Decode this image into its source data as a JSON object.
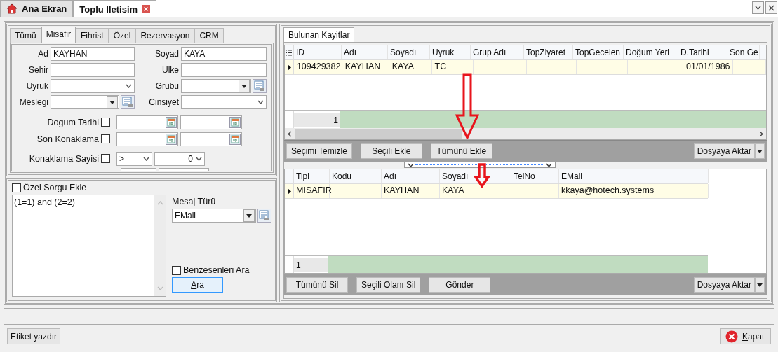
{
  "window_tabs": [
    {
      "label": "Ana Ekran",
      "selected": false,
      "kind": "home"
    },
    {
      "label": "Toplu Iletisim",
      "selected": true,
      "kind": "closable"
    }
  ],
  "filter_tabs": [
    {
      "label": "Tümü",
      "selected": false,
      "underline_first": false
    },
    {
      "label": "Misafir",
      "selected": true,
      "underline_first": true
    },
    {
      "label": "Fihrist",
      "selected": false,
      "underline_first": false
    },
    {
      "label": "Özel",
      "selected": false,
      "underline_first": false
    },
    {
      "label": "Rezervasyon",
      "selected": false,
      "underline_first": false
    },
    {
      "label": "CRM",
      "selected": false,
      "underline_first": false
    }
  ],
  "fields": [
    {
      "label": "Ad",
      "value": "KAYHAN",
      "kind": "text"
    },
    {
      "label": "Soyad",
      "value": "KAYA",
      "kind": "text"
    },
    {
      "label": "Sehir",
      "kind": "text"
    },
    {
      "label": "Ulke",
      "kind": "text"
    },
    {
      "label": "Uyruk",
      "kind": "select"
    },
    {
      "label": "Grubu",
      "kind": "lookup"
    },
    {
      "label": "Meslegi",
      "kind": "lookup"
    },
    {
      "label": "Cinsiyet",
      "kind": "select"
    }
  ],
  "range_filters": [
    {
      "label": "Dogum Tarihi",
      "checked": false,
      "kind": "date"
    },
    {
      "label": "Son Konaklama",
      "checked": false,
      "kind": "date"
    },
    {
      "label": "Konaklama Sayisi",
      "checked": false,
      "kind": "count",
      "operator": ">",
      "value": "0"
    }
  ],
  "custom_query": {
    "label": "Özel Sorgu Ekle",
    "checked": false,
    "text": "(1=1) and (2=2)"
  },
  "message_type": {
    "label": "Mesaj Türü",
    "value": "EMail"
  },
  "similar": {
    "label": "Benzesenleri Ara",
    "checked": false
  },
  "search_button": {
    "label": "Ara",
    "underline_first": true
  },
  "results": {
    "tab": "Bulunan Kayitlar",
    "columns": [
      "ID",
      "Adı",
      "Soyadı",
      "Uyruk",
      "Grup Adı",
      "TopZiyaret",
      "TopGecelen",
      "Doğum Yeri",
      "D.Tarihi",
      "Son Ge"
    ],
    "rows": [
      {
        "selected": true,
        "cells": [
          "109429382",
          "KAYHAN",
          "KAYA",
          "TC",
          "",
          "",
          "",
          "",
          "01/01/1986",
          ""
        ]
      }
    ],
    "count": "1",
    "buttons": [
      "Seçimi Temizle",
      "Seçili Ekle",
      "Tümünü Ekle"
    ],
    "export": "Dosyaya Aktar"
  },
  "recipients": {
    "columns": [
      "Tipi",
      "Kodu",
      "Adı",
      "Soyadı",
      "TelNo",
      "EMail"
    ],
    "rows": [
      {
        "selected": true,
        "cells": [
          "MISAFIR",
          "",
          "KAYHAN",
          "KAYA",
          "",
          "kkaya@hotech.systems"
        ]
      }
    ],
    "count": "1",
    "buttons": [
      "Tümünü Sil",
      "Seçili Olanı Sil",
      "Gönder"
    ],
    "export": "Dosyaya Aktar"
  },
  "footer": {
    "print_button": "Etiket yazdır",
    "close_button": {
      "label": "Kapat",
      "underline_first": true
    }
  }
}
